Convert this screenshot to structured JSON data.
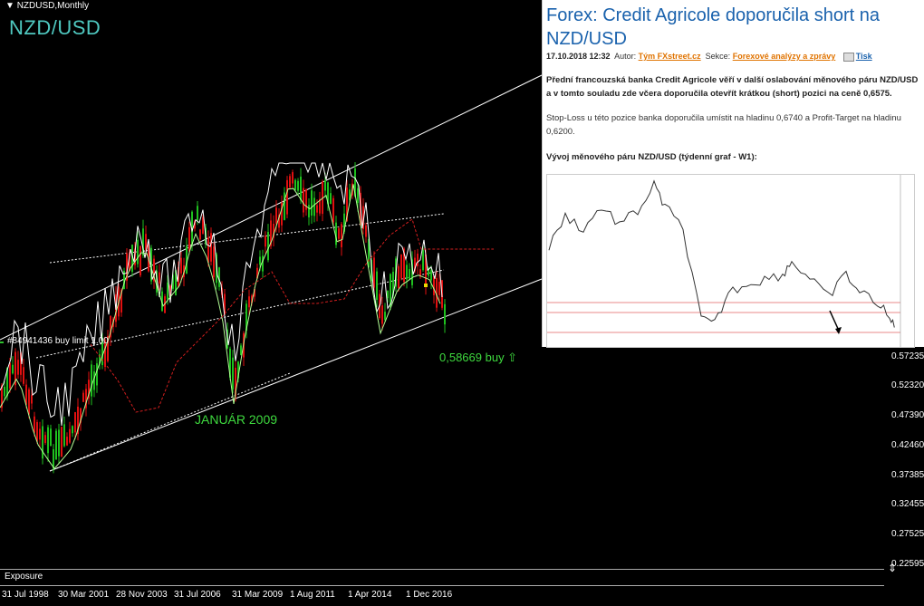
{
  "window": {
    "title": "NZDUSD,Monthly",
    "symbol": "NZD/USD"
  },
  "chart": {
    "order_label": "#84941436 buy limit 1.00",
    "buy_label": "0,58669 buy ⇧",
    "annotation": "JANUÁR 2009",
    "price_ticks": [
      "0.57235",
      "0.52320",
      "0.47390",
      "0.42460",
      "0.37385",
      "0.32455",
      "0.27525",
      "0.22595"
    ],
    "x_ticks": [
      "31 Jul 1998",
      "30 Mar 2001",
      "28 Nov 2003",
      "31 Jul 2006",
      "31 Mar 2009",
      "1 Aug 2011",
      "1 Apr 2014",
      "1 Dec 2016"
    ],
    "colors": {
      "bull": "#1fc01f",
      "bear": "#e01010",
      "channel": "#ffffff",
      "ma": "#b4ff96",
      "overlay": "#ffffff",
      "dash_red": "#d21e1e"
    }
  },
  "bottom_panel": {
    "label": "Exposure"
  },
  "article": {
    "title": "Forex: Credit Agricole doporučila short na NZD/USD",
    "date": "17.10.2018 12:32",
    "author_label": "Autor:",
    "author": "Tým FXstreet.cz",
    "section_label": "Sekce:",
    "section": "Forexové analýzy a zprávy",
    "print": "Tisk",
    "p1": "Přední francouzská banka Credit Agricole věří v další oslabování měnového páru NZD/USD a v tomto souladu zde včera doporučila otevřít krátkou (short) pozici na ceně 0,6575.",
    "p2": "Stop-Loss u této pozice banka doporučila umístit na hladinu 0,6740 a Profit-Target na hladinu 0,6200.",
    "p3": "Vývoj měnového páru NZD/USD (týdenní graf - W1):"
  }
}
